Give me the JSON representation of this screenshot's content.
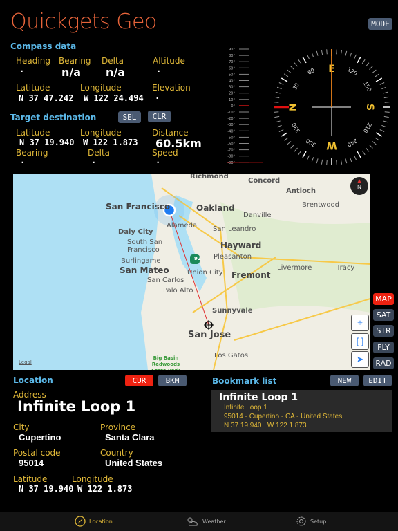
{
  "app": {
    "title": "Quickgets Geo",
    "mode_button": "MODE"
  },
  "compass_data": {
    "section_title": "Compass data",
    "heading": {
      "label": "Heading",
      "value": "·"
    },
    "bearing": {
      "label": "Bearing",
      "value": "n/a"
    },
    "delta": {
      "label": "Delta",
      "value": "n/a"
    },
    "altitude": {
      "label": "Altitude",
      "value": "·"
    },
    "latitude": {
      "label": "Latitude",
      "value": "N 37 47.242"
    },
    "longitude": {
      "label": "Longitude",
      "value": "W 122 24.494"
    },
    "elevation": {
      "label": "Elevation",
      "value": "·"
    }
  },
  "target": {
    "section_title": "Target destination",
    "sel_button": "SEL",
    "clr_button": "CLR",
    "latitude": {
      "label": "Latitude",
      "value": "N 37 19.940"
    },
    "longitude": {
      "label": "Longitude",
      "value": "W 122 1.873"
    },
    "distance": {
      "label": "Distance",
      "value": "60.5km"
    },
    "bearing": {
      "label": "Bearing",
      "value": "·"
    },
    "delta": {
      "label": "Delta",
      "value": "·"
    },
    "speed": {
      "label": "Speed",
      "value": "·"
    }
  },
  "inclinometer": {
    "ticks": [
      "90°",
      "80°",
      "70°",
      "60°",
      "50°",
      "40°",
      "30°",
      "20°",
      "10°",
      "0°",
      "-10°",
      "-20°",
      "-30°",
      "-40°",
      "-50°",
      "-60°",
      "-70°",
      "-80°",
      "-90°"
    ],
    "current_degrees": -90
  },
  "compass": {
    "cardinals": {
      "north": "N",
      "east": "E",
      "south": "S",
      "west": "W"
    },
    "degree_labels": [
      "30",
      "60",
      "120",
      "150",
      "210",
      "240",
      "300",
      "330"
    ],
    "heading_degrees": 90
  },
  "map": {
    "cities": [
      {
        "name": "Richmond"
      },
      {
        "name": "Concord"
      },
      {
        "name": "Antioch"
      },
      {
        "name": "San Francisco"
      },
      {
        "name": "Oakland"
      },
      {
        "name": "Brentwood"
      },
      {
        "name": "Danville"
      },
      {
        "name": "Alameda"
      },
      {
        "name": "Daly City"
      },
      {
        "name": "San Leandro"
      },
      {
        "name": "South San Francisco"
      },
      {
        "name": "Hayward"
      },
      {
        "name": "Burlingame"
      },
      {
        "name": "Pleasanton"
      },
      {
        "name": "San Mateo"
      },
      {
        "name": "Livermore"
      },
      {
        "name": "Tracy"
      },
      {
        "name": "Union City"
      },
      {
        "name": "Fremont"
      },
      {
        "name": "San Carlos"
      },
      {
        "name": "Palo Alto"
      },
      {
        "name": "Sunnyvale"
      },
      {
        "name": "San Jose"
      },
      {
        "name": "Los Gatos"
      },
      {
        "name": "Big Basin Redwoods State Park"
      }
    ],
    "route_shield": "92",
    "legal": "Legal",
    "compass_badge": "N",
    "types": [
      {
        "label": "MAP",
        "active": true
      },
      {
        "label": "SAT",
        "active": false
      },
      {
        "label": "STR",
        "active": false
      },
      {
        "label": "FLY",
        "active": false
      },
      {
        "label": "RAD",
        "active": false
      }
    ]
  },
  "location": {
    "section_title": "Location",
    "cur_button": "CUR",
    "bkm_button": "BKM",
    "address": {
      "label": "Address",
      "value": "Infinite Loop 1"
    },
    "city": {
      "label": "City",
      "value": "Cupertino"
    },
    "province": {
      "label": "Province",
      "value": "Santa Clara"
    },
    "postal_code": {
      "label": "Postal code",
      "value": "95014"
    },
    "country": {
      "label": "Country",
      "value": "United States"
    },
    "latitude": {
      "label": "Latitude",
      "value": "N 37 19.940"
    },
    "longitude": {
      "label": "Longitude",
      "value": "W 122 1.873"
    }
  },
  "bookmarks": {
    "section_title": "Bookmark list",
    "new_button": "NEW",
    "edit_button": "EDIT",
    "items": [
      {
        "title": "Infinite Loop 1",
        "line1": "Infinite Loop 1",
        "line2": "95014 - Cupertino - CA - United States",
        "line3": "N 37 19.940   W 122 1.873"
      }
    ]
  },
  "tabbar": {
    "tabs": [
      {
        "label": "Location",
        "icon": "compass-icon",
        "active": true
      },
      {
        "label": "Weather",
        "icon": "weather-icon",
        "active": false
      },
      {
        "label": "Setup",
        "icon": "gear-icon",
        "active": false
      }
    ]
  }
}
